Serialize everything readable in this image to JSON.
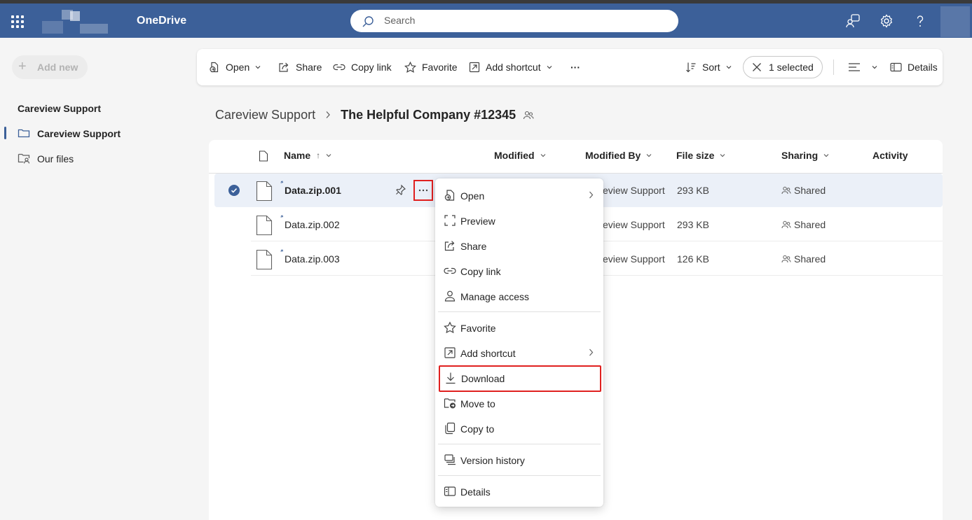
{
  "app": {
    "name": "OneDrive"
  },
  "search": {
    "placeholder": "Search"
  },
  "sidebar": {
    "add_new": "Add new",
    "heading": "Careview Support",
    "items": [
      {
        "label": "Careview Support",
        "active": true,
        "icon": "folder-icon"
      },
      {
        "label": "Our files",
        "active": false,
        "icon": "shared-folder-icon"
      }
    ]
  },
  "toolbar": {
    "open": "Open",
    "share": "Share",
    "copy_link": "Copy link",
    "favorite": "Favorite",
    "add_shortcut": "Add shortcut",
    "more": "···",
    "sort": "Sort",
    "selected": "1 selected",
    "details": "Details"
  },
  "breadcrumb": {
    "root": "Careview Support",
    "separator": "›",
    "current": "The Helpful Company #12345"
  },
  "columns": {
    "name": "Name",
    "name_sort": "↑",
    "modified": "Modified",
    "modified_by": "Modified By",
    "file_size": "File size",
    "sharing": "Sharing",
    "activity": "Activity"
  },
  "files": [
    {
      "name": "Data.zip.001",
      "modified_by": "eview Support",
      "size": "293 KB",
      "sharing": "Shared",
      "selected": true
    },
    {
      "name": "Data.zip.002",
      "modified_by": "eview Support",
      "size": "293 KB",
      "sharing": "Shared",
      "selected": false
    },
    {
      "name": "Data.zip.003",
      "modified_by": "eview Support",
      "size": "126 KB",
      "sharing": "Shared",
      "selected": false
    }
  ],
  "context_menu": {
    "items": [
      {
        "label": "Open",
        "icon": "open-icon",
        "submenu": true
      },
      {
        "label": "Preview",
        "icon": "preview-icon"
      },
      {
        "label": "Share",
        "icon": "share-icon"
      },
      {
        "label": "Copy link",
        "icon": "link-icon"
      },
      {
        "label": "Manage access",
        "icon": "person-icon"
      },
      {
        "label": "Favorite",
        "icon": "star-icon"
      },
      {
        "label": "Add shortcut",
        "icon": "shortcut-icon",
        "submenu": true
      },
      {
        "label": "Download",
        "icon": "download-icon",
        "highlighted": true
      },
      {
        "label": "Move to",
        "icon": "move-icon"
      },
      {
        "label": "Copy to",
        "icon": "copy-icon"
      },
      {
        "label": "Version history",
        "icon": "history-icon"
      },
      {
        "label": "Details",
        "icon": "details-icon"
      }
    ]
  },
  "colors": {
    "header": "#3c6099",
    "highlight": "#e0201f",
    "selected_row": "#ebf0f8"
  }
}
